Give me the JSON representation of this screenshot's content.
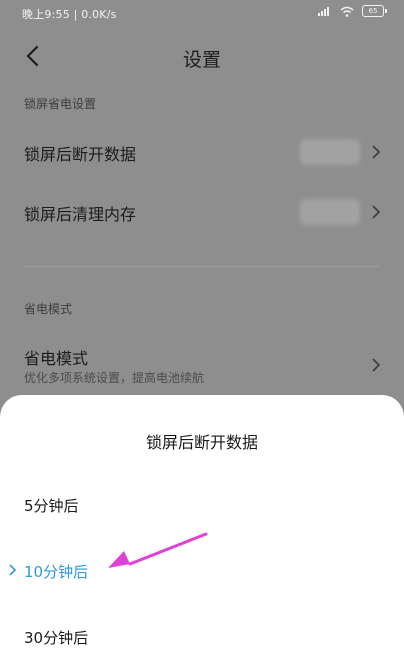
{
  "status_bar": {
    "time": "晚上9:55 | 0.0K/s",
    "battery": "65",
    "icons": [
      "signal-icon",
      "wifi-icon",
      "battery-icon"
    ]
  },
  "header": {
    "title": "设置",
    "back_icon": "chevron-left-icon"
  },
  "section_lock": {
    "title": "锁屏省电设置"
  },
  "rows": [
    {
      "label": "锁屏后断开数据"
    },
    {
      "label": "锁屏后清理内存"
    }
  ],
  "section_power": {
    "title": "省电模式"
  },
  "power_mode": {
    "label": "省电模式",
    "subtitle": "优化多项系统设置，提高电池续航"
  },
  "sheet": {
    "title": "锁屏后断开数据",
    "options": [
      {
        "label": "5分钟后",
        "selected": false
      },
      {
        "label": "10分钟后",
        "selected": true
      },
      {
        "label": "30分钟后",
        "selected": false
      }
    ]
  },
  "colors": {
    "accent": "#2e9ad6",
    "annotation_arrow": "#e040d8",
    "overlay": "#8e8e8e"
  }
}
